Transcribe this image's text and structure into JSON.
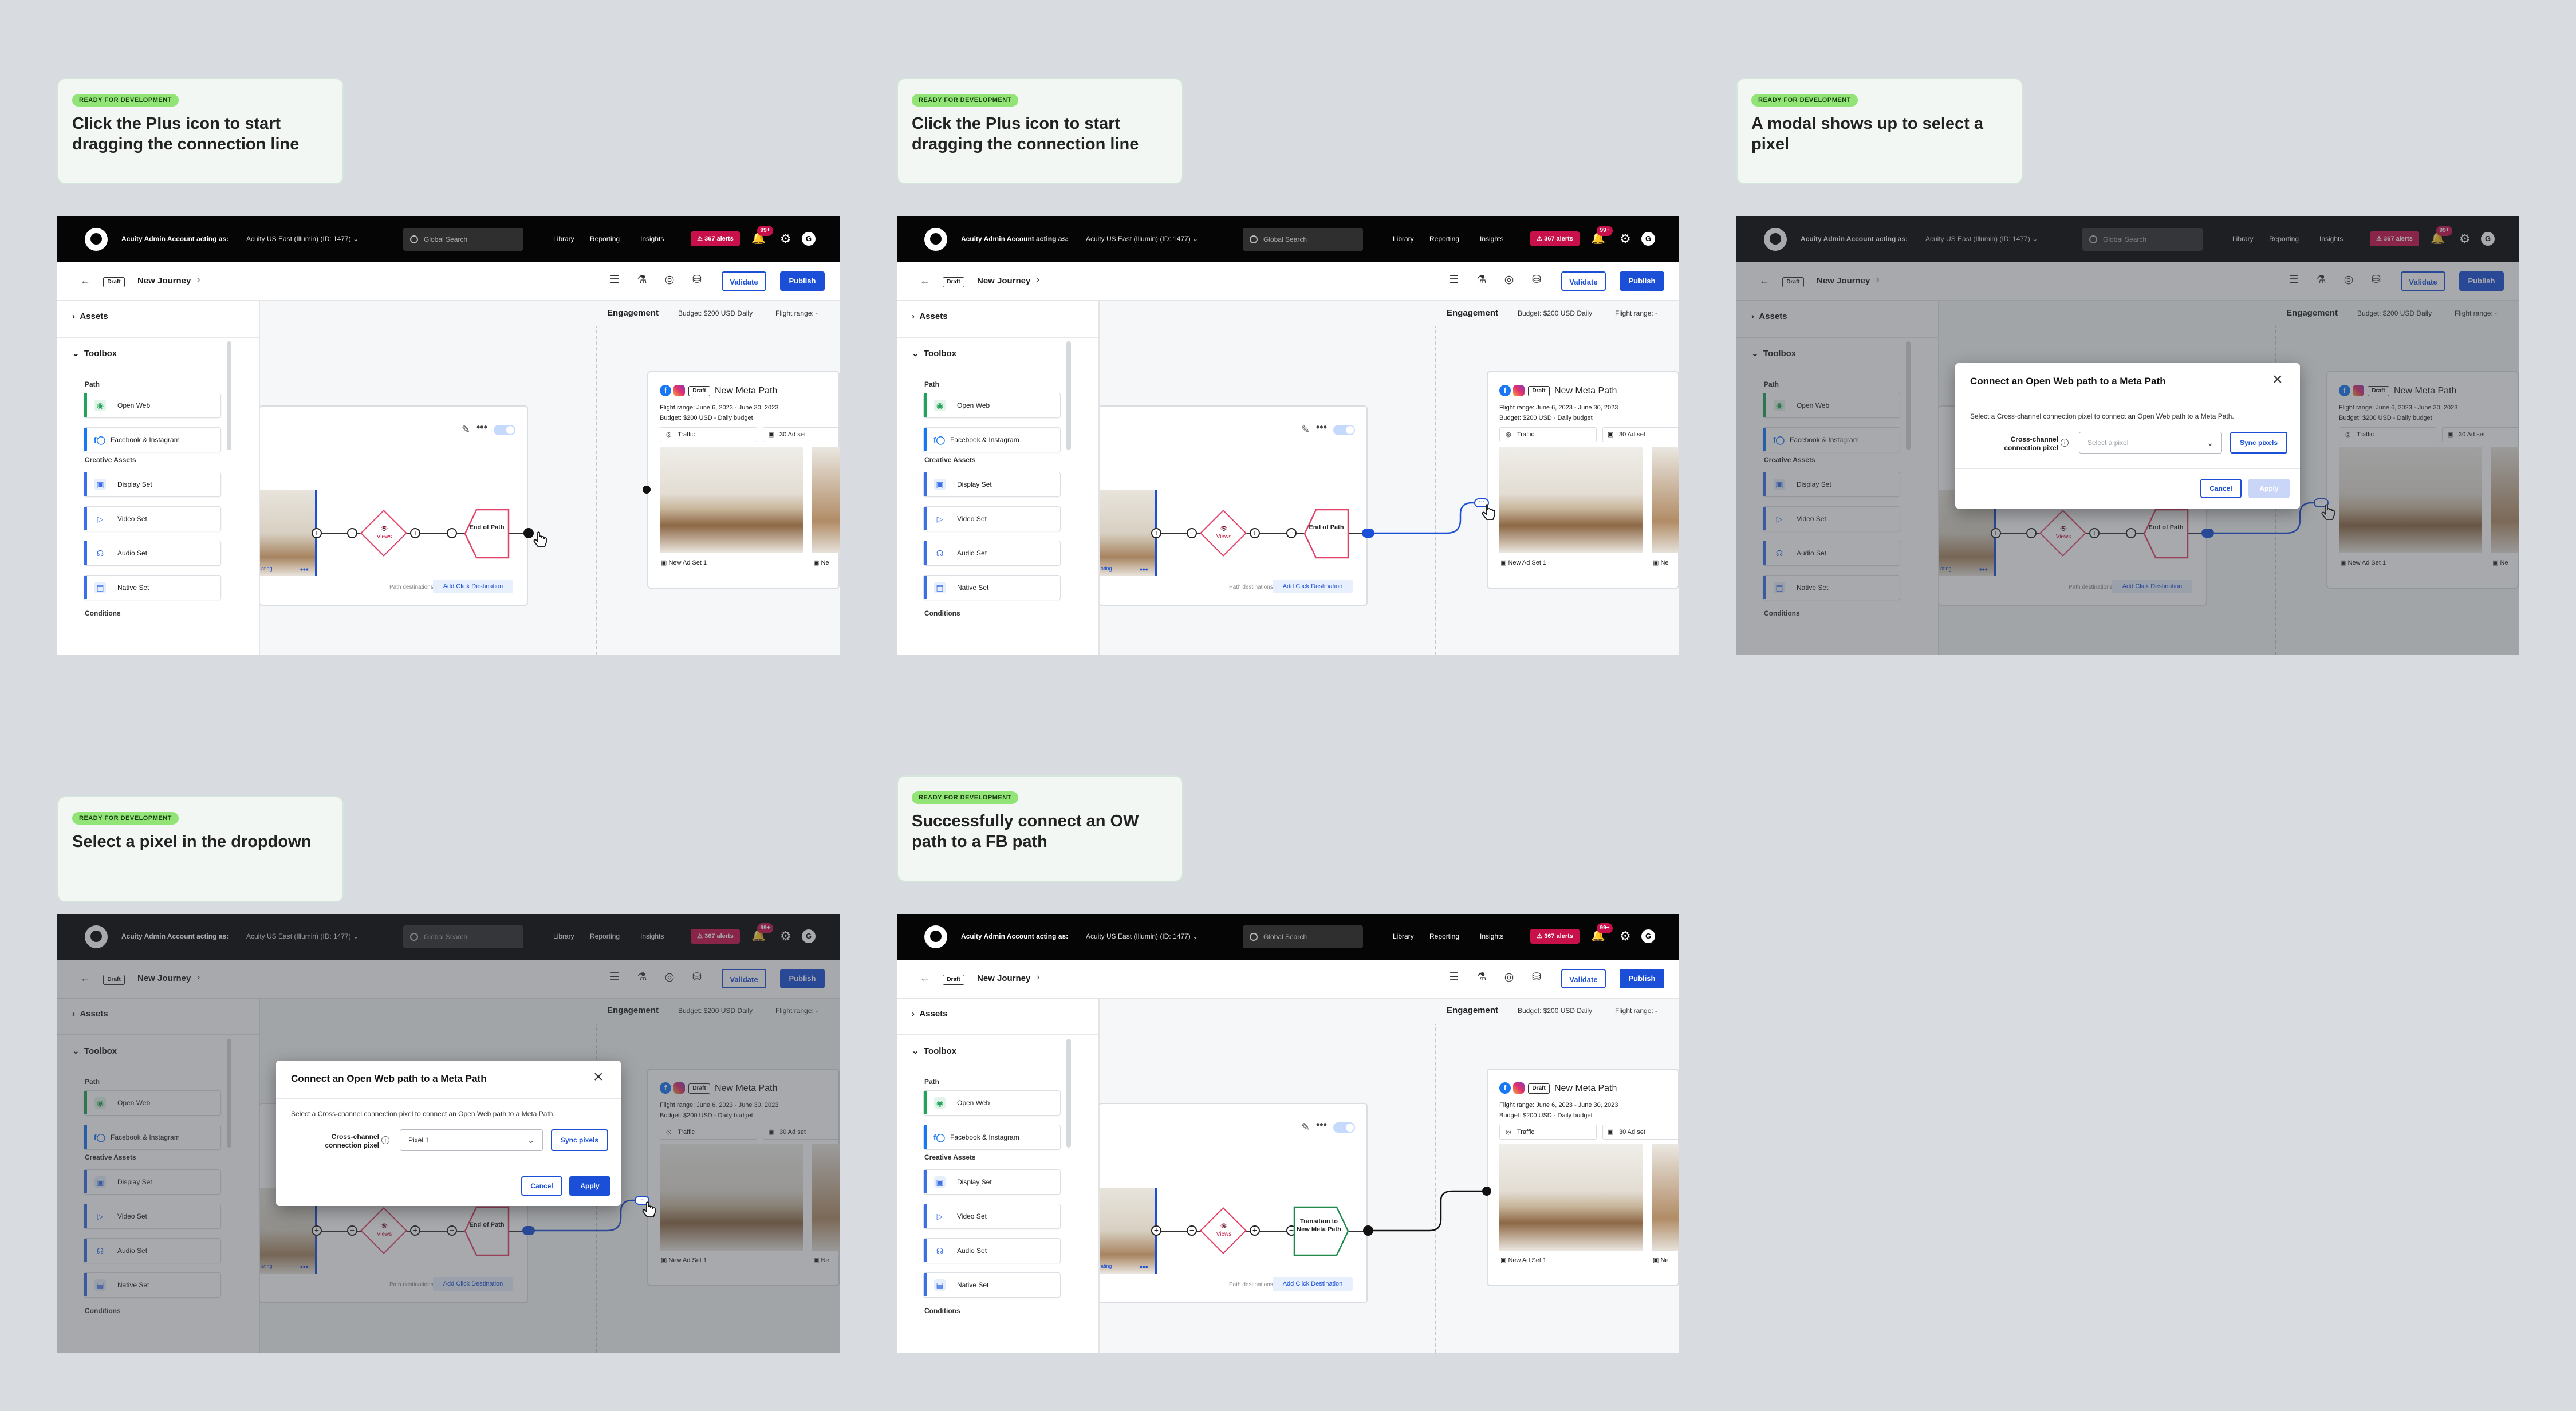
{
  "notes": [
    {
      "badge": "READY FOR DEVELOPMENT",
      "text": "Click the Plus icon to start dragging the connection line"
    },
    {
      "badge": "READY FOR DEVELOPMENT",
      "text": "Click the Plus icon to start dragging the connection line"
    },
    {
      "badge": "READY FOR DEVELOPMENT",
      "text": "A modal shows up to select a pixel"
    },
    {
      "badge": "READY FOR DEVELOPMENT",
      "text": "Select a pixel in the dropdown"
    },
    {
      "badge": "READY FOR DEVELOPMENT",
      "text": "Successfully connect an OW path to a FB path"
    }
  ],
  "app": {
    "account_label": "Acuity Admin Account acting as:",
    "account_value": "Acuity US East (Illumin) (ID: 1477)",
    "search_placeholder": "Global Search",
    "nav": [
      "Library",
      "Reporting",
      "Insights"
    ],
    "alerts": "367 alerts",
    "bell_badge": "99+",
    "avatar": "G",
    "draft": "Draft",
    "journey_title": "New Journey",
    "validate": "Validate",
    "publish": "Publish",
    "toolbar_icons": [
      "sliders-icon",
      "flask-icon",
      "target-icon",
      "stack-icon"
    ]
  },
  "left_panel": {
    "assets": "Assets",
    "toolbox": "Toolbox",
    "path_group": "Path",
    "path_items": [
      {
        "label": "Open Web",
        "color": "#22a35a",
        "icon": "open-web-icon"
      },
      {
        "label": "Facebook & Instagram",
        "color": "#1877f2",
        "icon": "facebook-instagram-icon"
      }
    ],
    "creative_group": "Creative Assets",
    "creative_items": [
      {
        "label": "Display Set",
        "icon": "display-set-icon"
      },
      {
        "label": "Video Set",
        "icon": "video-set-icon"
      },
      {
        "label": "Audio Set",
        "icon": "audio-set-icon"
      },
      {
        "label": "Native Set",
        "icon": "native-set-icon"
      }
    ],
    "conditions_group": "Conditions"
  },
  "engagement": {
    "title": "Engagement",
    "budget": "Budget: $200 USD Daily",
    "flight": "Flight range: -"
  },
  "open_web_path": {
    "views_count": "5",
    "views_label": "Views",
    "end_label": "End of Path",
    "transition_label": "Transition to New Meta Path",
    "path_destinations": "Path destinations:",
    "add_click_destination": "Add Click Destination",
    "thumb_label": "ating"
  },
  "meta_path": {
    "draft": "Draft",
    "title": "New Meta Path",
    "flight": "Flight range: June 6, 2023 - June 30, 2023",
    "budget": "Budget: $200 USD - Daily budget",
    "objective": "Traffic",
    "ad_set_count": "30 Ad set",
    "ad_set_name": "New Ad Set 1",
    "ad_set_name_2": "Ne"
  },
  "modal": {
    "title": "Connect an Open Web path to a Meta Path",
    "description": "Select a Cross-channel connection pixel to connect an Open Web path to a Meta Path.",
    "field_label": "Cross-channel connection pixel",
    "select_placeholder": "Select a pixel",
    "selected_value": "Pixel 1",
    "sync": "Sync pixels",
    "cancel": "Cancel",
    "apply": "Apply"
  },
  "colors": {
    "accent": "#1b4fd8",
    "badge_green": "#93e477",
    "alert_red": "#c8104a",
    "end_node_red": "#e34268",
    "transition_green": "#1f8a4c"
  }
}
